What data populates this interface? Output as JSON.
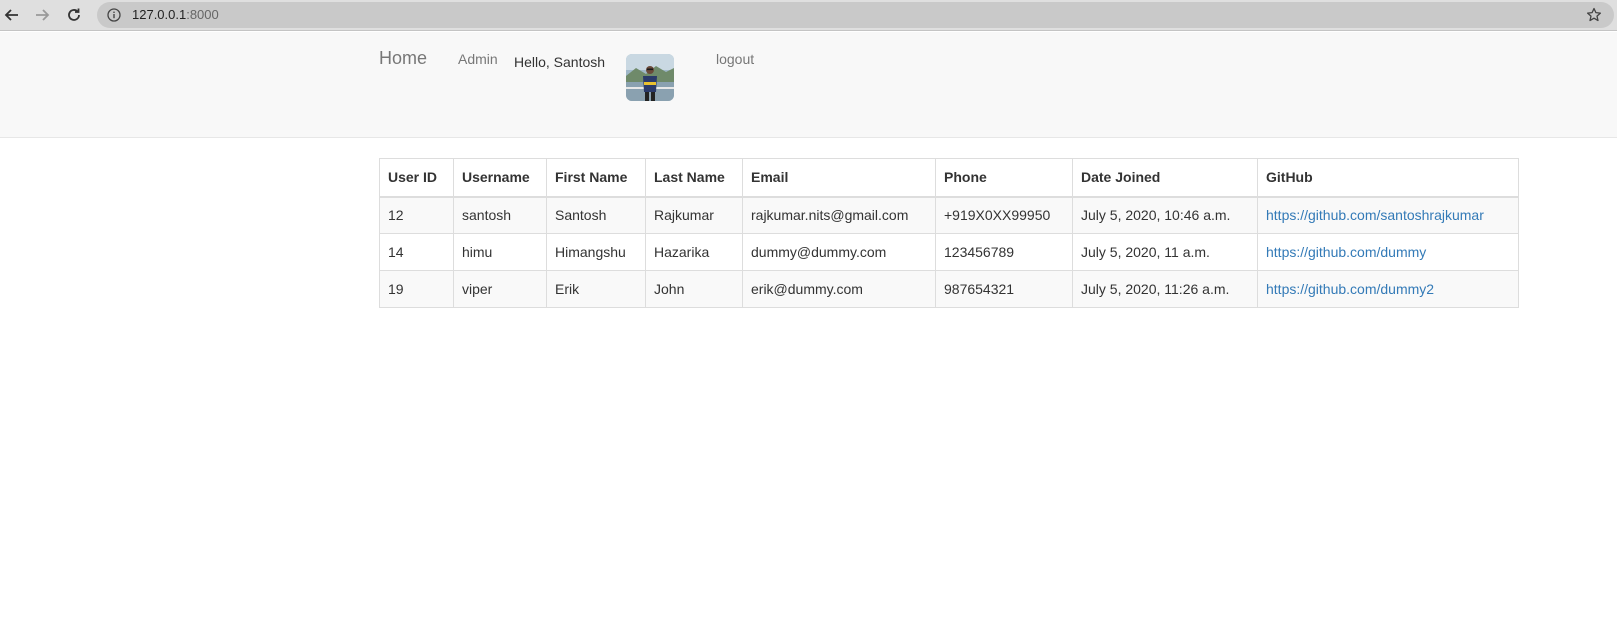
{
  "browser": {
    "url_host": "127.0.0.1",
    "url_port": ":8000"
  },
  "navbar": {
    "home_label": "Home",
    "admin_label": "Admin",
    "greeting": "Hello, Santosh",
    "logout_label": "logout"
  },
  "table": {
    "headers": [
      "User ID",
      "Username",
      "First Name",
      "Last Name",
      "Email",
      "Phone",
      "Date Joined",
      "GitHub"
    ],
    "rows": [
      {
        "user_id": "12",
        "username": "santosh",
        "first_name": "Santosh",
        "last_name": "Rajkumar",
        "email": "rajkumar.nits@gmail.com",
        "phone": "+919X0XX99950",
        "date_joined": "July 5, 2020, 10:46 a.m.",
        "github": "https://github.com/santoshrajkumar"
      },
      {
        "user_id": "14",
        "username": "himu",
        "first_name": "Himangshu",
        "last_name": "Hazarika",
        "email": "dummy@dummy.com",
        "phone": "123456789",
        "date_joined": "July 5, 2020, 11 a.m.",
        "github": "https://github.com/dummy"
      },
      {
        "user_id": "19",
        "username": "viper",
        "first_name": "Erik",
        "last_name": "John",
        "email": "erik@dummy.com",
        "phone": "987654321",
        "date_joined": "July 5, 2020, 11:26 a.m.",
        "github": "https://github.com/dummy2"
      }
    ]
  },
  "colors": {
    "link": "#337ab7",
    "navbar_bg": "#f8f8f8",
    "row_stripe": "#f9f9f9"
  }
}
